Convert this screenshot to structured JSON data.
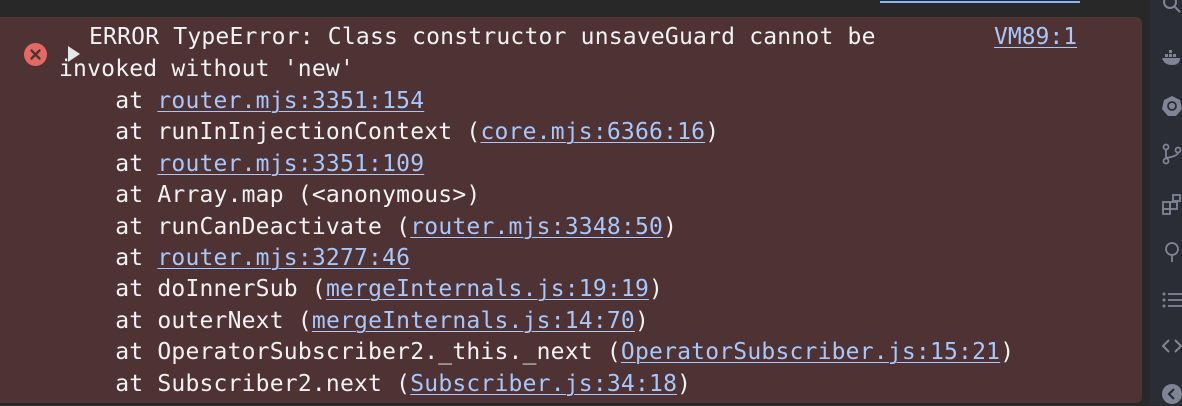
{
  "error": {
    "message_line1": "ERROR TypeError: Class constructor unsaveGuard cannot be",
    "message_line2": "invoked without 'new'",
    "source": "VM89:1",
    "stack": [
      {
        "prefix": "    at ",
        "func": "",
        "link": "router.mjs:3351:154"
      },
      {
        "prefix": "    at ",
        "func": "runInInjectionContext ",
        "link": "core.mjs:6366:16"
      },
      {
        "prefix": "    at ",
        "func": "",
        "link": "router.mjs:3351:109"
      },
      {
        "prefix": "    at ",
        "func": "Array.map (<anonymous>)",
        "link": ""
      },
      {
        "prefix": "    at ",
        "func": "runCanDeactivate ",
        "link": "router.mjs:3348:50"
      },
      {
        "prefix": "    at ",
        "func": "",
        "link": "router.mjs:3277:46"
      },
      {
        "prefix": "    at ",
        "func": "doInnerSub ",
        "link": "mergeInternals.js:19:19"
      },
      {
        "prefix": "    at ",
        "func": "outerNext ",
        "link": "mergeInternals.js:14:70"
      },
      {
        "prefix": "    at ",
        "func": "OperatorSubscriber2._this._next ",
        "link": "OperatorSubscriber.js:15:21"
      },
      {
        "prefix": "    at ",
        "func": "Subscriber2.next ",
        "link": "Subscriber.js:34:18"
      }
    ]
  },
  "icons": {
    "error": "error-circle-icon",
    "expand": "expand-triangle-icon",
    "sidebar": [
      "search-icon",
      "docker-icon",
      "kubernetes-icon",
      "source-control-icon",
      "extensions-icon",
      "tree-icon",
      "list-icon",
      "code-icon",
      "chevron-icon"
    ]
  },
  "colors": {
    "error_bg": "#4e3234",
    "error_icon": "#e46962",
    "link": "#a8c7fa",
    "text": "#f2f2f2"
  }
}
